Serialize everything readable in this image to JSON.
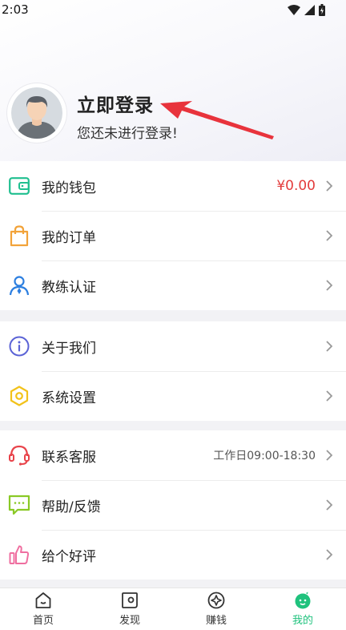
{
  "status": {
    "time": "2:03"
  },
  "profile": {
    "login_title": "立即登录",
    "login_subtitle": "您还未进行登录!"
  },
  "menu_groups": [
    {
      "items": [
        {
          "label": "我的钱包",
          "icon": "wallet-icon",
          "value": "¥0.00"
        },
        {
          "label": "我的订单",
          "icon": "shopping-bag-icon"
        },
        {
          "label": "教练认证",
          "icon": "coach-icon"
        }
      ]
    },
    {
      "items": [
        {
          "label": "关于我们",
          "icon": "info-icon"
        },
        {
          "label": "系统设置",
          "icon": "settings-icon"
        }
      ]
    },
    {
      "items": [
        {
          "label": "联系客服",
          "icon": "headset-icon",
          "note": "工作日09:00-18:30"
        },
        {
          "label": "帮助/反馈",
          "icon": "feedback-icon"
        },
        {
          "label": "给个好评",
          "icon": "thumbs-up-icon"
        }
      ]
    }
  ],
  "tabbar": [
    {
      "label": "首页",
      "icon": "home-icon"
    },
    {
      "label": "发现",
      "icon": "discover-icon"
    },
    {
      "label": "赚钱",
      "icon": "earn-icon"
    },
    {
      "label": "我的",
      "icon": "mine-icon",
      "active": true
    }
  ],
  "colors": {
    "accent": "#1fc27d",
    "price": "#e33b3b",
    "arrow": "#e8333c"
  }
}
